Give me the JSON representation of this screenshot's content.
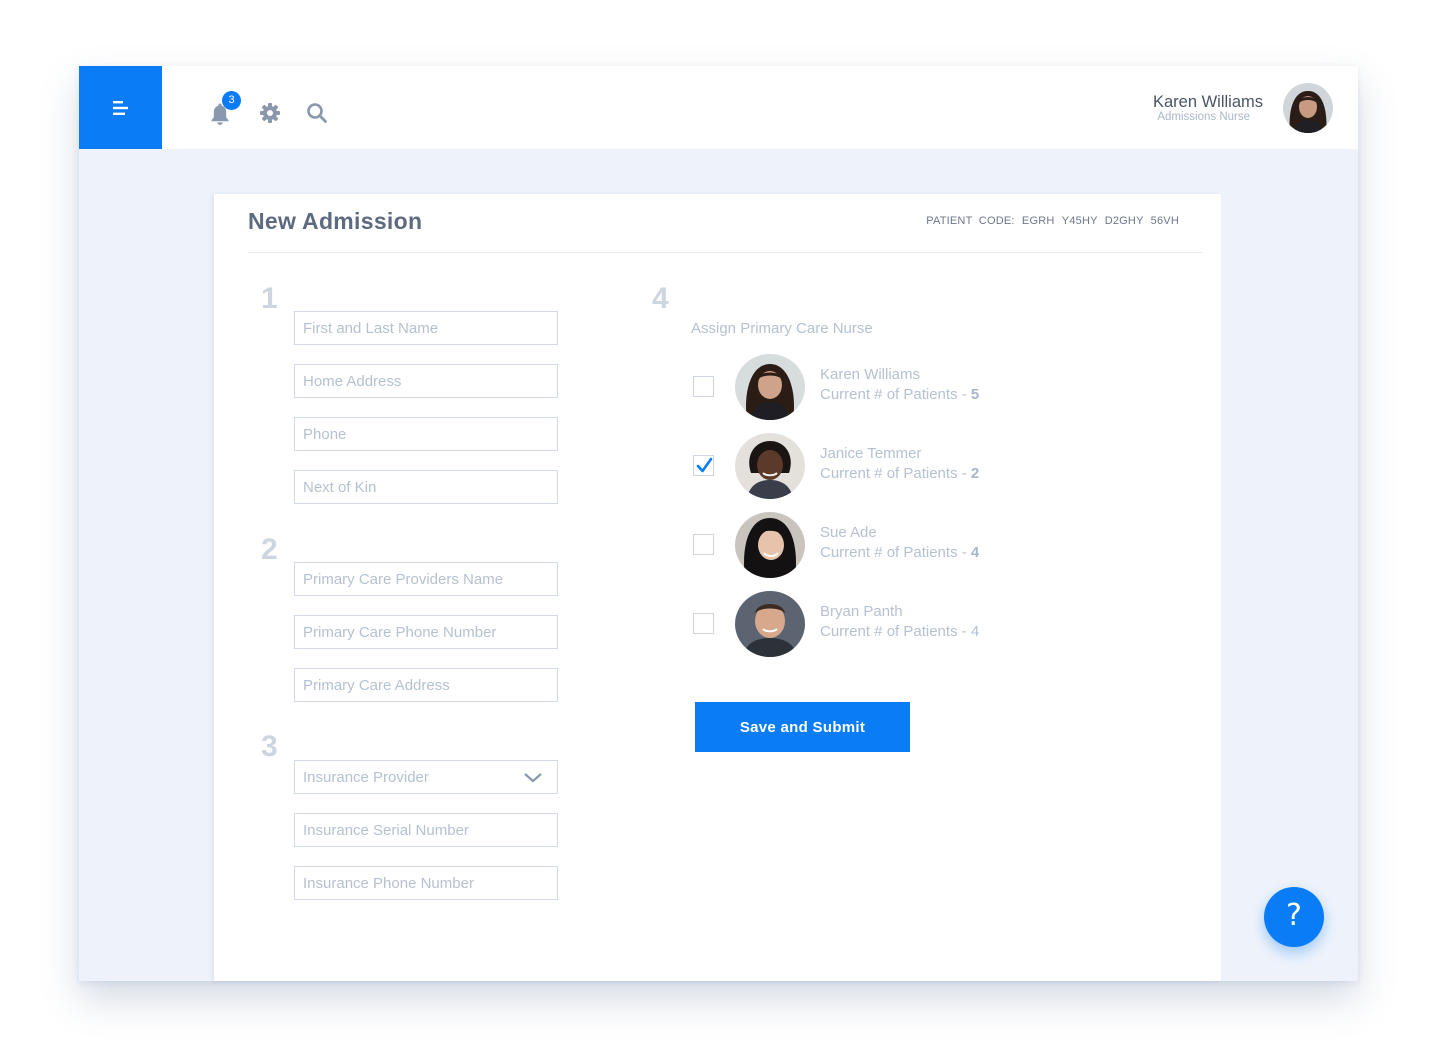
{
  "header": {
    "notifications_count": "3",
    "user_name": "Karen Williams",
    "user_role": "Admissions Nurse"
  },
  "form": {
    "title": "New Admission",
    "patient_code_label": "PATIENT  CODE:",
    "patient_code_parts": [
      "EGRH",
      "Y45HY",
      "D2GHY",
      "56VH"
    ],
    "steps": [
      "1",
      "2",
      "3",
      "4"
    ],
    "section1": {
      "name_placeholder": "First and Last Name",
      "address_placeholder": "Home Address",
      "phone_placeholder": "Phone",
      "kin_placeholder": "Next of Kin"
    },
    "section2": {
      "provider_name_placeholder": "Primary Care Providers Name",
      "provider_phone_placeholder": "Primary Care Phone Number",
      "provider_address_placeholder": "Primary Care Address"
    },
    "section3": {
      "insurance_provider_label": "Insurance Provider",
      "insurance_serial_placeholder": "Insurance Serial Number",
      "insurance_phone_placeholder": "Insurance Phone Number"
    },
    "section4": {
      "assign_label": "Assign Primary Care Nurse",
      "count_prefix": "Current # of Patients - ",
      "nurses": [
        {
          "name": "Karen Williams",
          "patients": "5",
          "checked": false
        },
        {
          "name": "Janice Temmer",
          "patients": "2",
          "checked": true
        },
        {
          "name": "Sue Ade",
          "patients": "4",
          "checked": false
        },
        {
          "name": "Bryan Panth",
          "patients": "4",
          "checked": false
        }
      ]
    },
    "submit_label": "Save and Submit"
  },
  "help_label": "?",
  "colors": {
    "accent": "#0a7cf6",
    "background": "#eef3fb",
    "muted_text": "#b6c1d0"
  },
  "icons": [
    "menu-icon",
    "bell-icon",
    "gear-icon",
    "search-icon",
    "chevron-down-icon",
    "check-icon",
    "help-icon"
  ]
}
